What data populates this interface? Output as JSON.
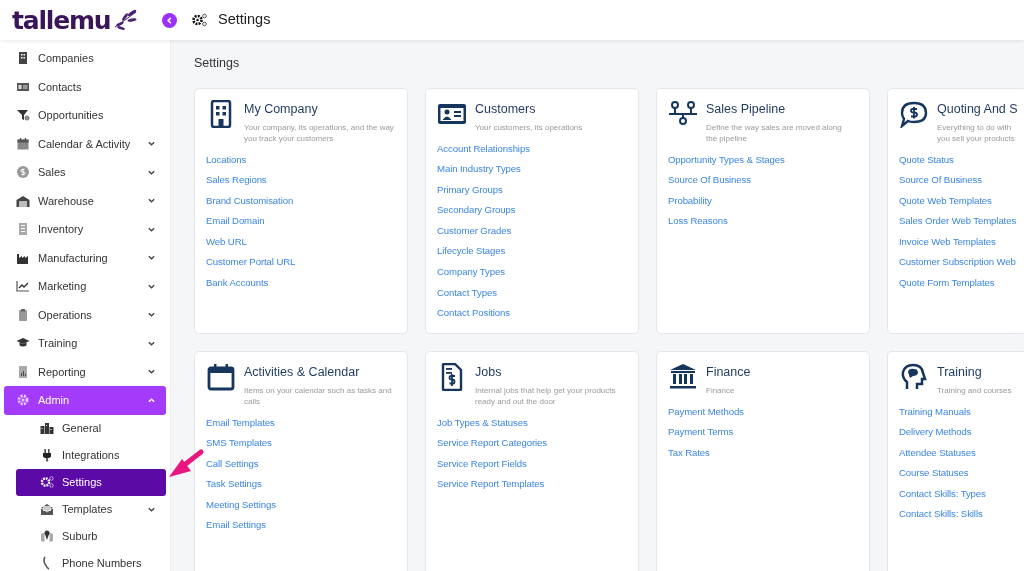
{
  "logo": {
    "text": "tallemu"
  },
  "header": {
    "title": "Settings"
  },
  "sidebar": {
    "items": [
      {
        "label": "Companies",
        "selected": false
      },
      {
        "label": "Contacts",
        "selected": false
      },
      {
        "label": "Opportunities",
        "selected": false
      },
      {
        "label": "Calendar & Activity",
        "selected": false,
        "expanded": false
      },
      {
        "label": "Sales",
        "selected": false,
        "expanded": false
      },
      {
        "label": "Warehouse",
        "selected": false,
        "expanded": false
      },
      {
        "label": "Inventory",
        "selected": false,
        "expanded": false
      },
      {
        "label": "Manufacturing",
        "selected": false,
        "expanded": false
      },
      {
        "label": "Marketing",
        "selected": false,
        "expanded": false
      },
      {
        "label": "Operations",
        "selected": false,
        "expanded": false
      },
      {
        "label": "Training",
        "selected": false,
        "expanded": false
      },
      {
        "label": "Reporting",
        "selected": false,
        "expanded": false
      },
      {
        "label": "Admin",
        "selected": true,
        "expanded": true,
        "children": [
          {
            "label": "General",
            "selected": false
          },
          {
            "label": "Integrations",
            "selected": false
          },
          {
            "label": "Settings",
            "selected": true
          },
          {
            "label": "Templates",
            "selected": false,
            "expanded": false
          },
          {
            "label": "Suburb",
            "selected": false
          },
          {
            "label": "Phone Numbers",
            "selected": false
          }
        ]
      }
    ]
  },
  "page_title": "Settings",
  "cards": [
    {
      "title": "My Company",
      "desc_lines": [
        "Your company, its operations, and the way",
        "you track your customers"
      ],
      "links": [
        "Locations",
        "Sales Regions",
        "Brand Customisation",
        "Email Domain",
        "Web URL",
        "Customer Portal URL",
        "Bank Accounts"
      ]
    },
    {
      "title": "Customers",
      "desc_lines": [
        "Your customers, its operations"
      ],
      "links": [
        "Account Relationships",
        "Main Industry Types",
        "Primary Groups",
        "Secondary Groups",
        "Customer Grades",
        "Lifecycle Stages",
        "Company Types",
        "Contact Types",
        "Contact Positions"
      ]
    },
    {
      "title": "Sales Pipeline",
      "desc_lines": [
        "Define the way sales are moved along",
        "the pipeline"
      ],
      "links": [
        "Opportunity Types & Stages",
        "Source Of Business",
        "Probability",
        "Loss Reasons"
      ]
    },
    {
      "title": "Quoting And S",
      "desc_lines": [
        "Everything to do with",
        "you sell your products"
      ],
      "links": [
        "Quote Status",
        "Source Of Business",
        "Quote Web Templates",
        "Sales Order Web Templates",
        "Invoice Web Templates",
        "Customer Subscription Web",
        "Quote Form Templates"
      ]
    },
    {
      "title": "Activities & Calendar",
      "desc_lines": [
        "Items on your calendar such as tasks and",
        "calls"
      ],
      "links": [
        "Email Templates",
        "SMS Templates",
        "Call Settings",
        "Task Settings",
        "Meeting Settings",
        "Email Settings"
      ]
    },
    {
      "title": "Jobs",
      "desc_lines": [
        "Internal jobs that help get your products",
        "ready and out the door"
      ],
      "links": [
        "Job Types & Statuses",
        "Service Report Categories",
        "Service Report Fields",
        "Service Report Templates"
      ]
    },
    {
      "title": "Finance",
      "desc_lines": [
        "Finance"
      ],
      "links": [
        "Payment Methods",
        "Payment Terms",
        "Tax Rates"
      ]
    },
    {
      "title": "Training",
      "desc_lines": [
        "Training and courses"
      ],
      "links": [
        "Training Manuals",
        "Delivery Methods",
        "Attendee Statuses",
        "Course Statuses",
        "Contact Skills: Types",
        "Contact Skills: Skills"
      ]
    }
  ]
}
